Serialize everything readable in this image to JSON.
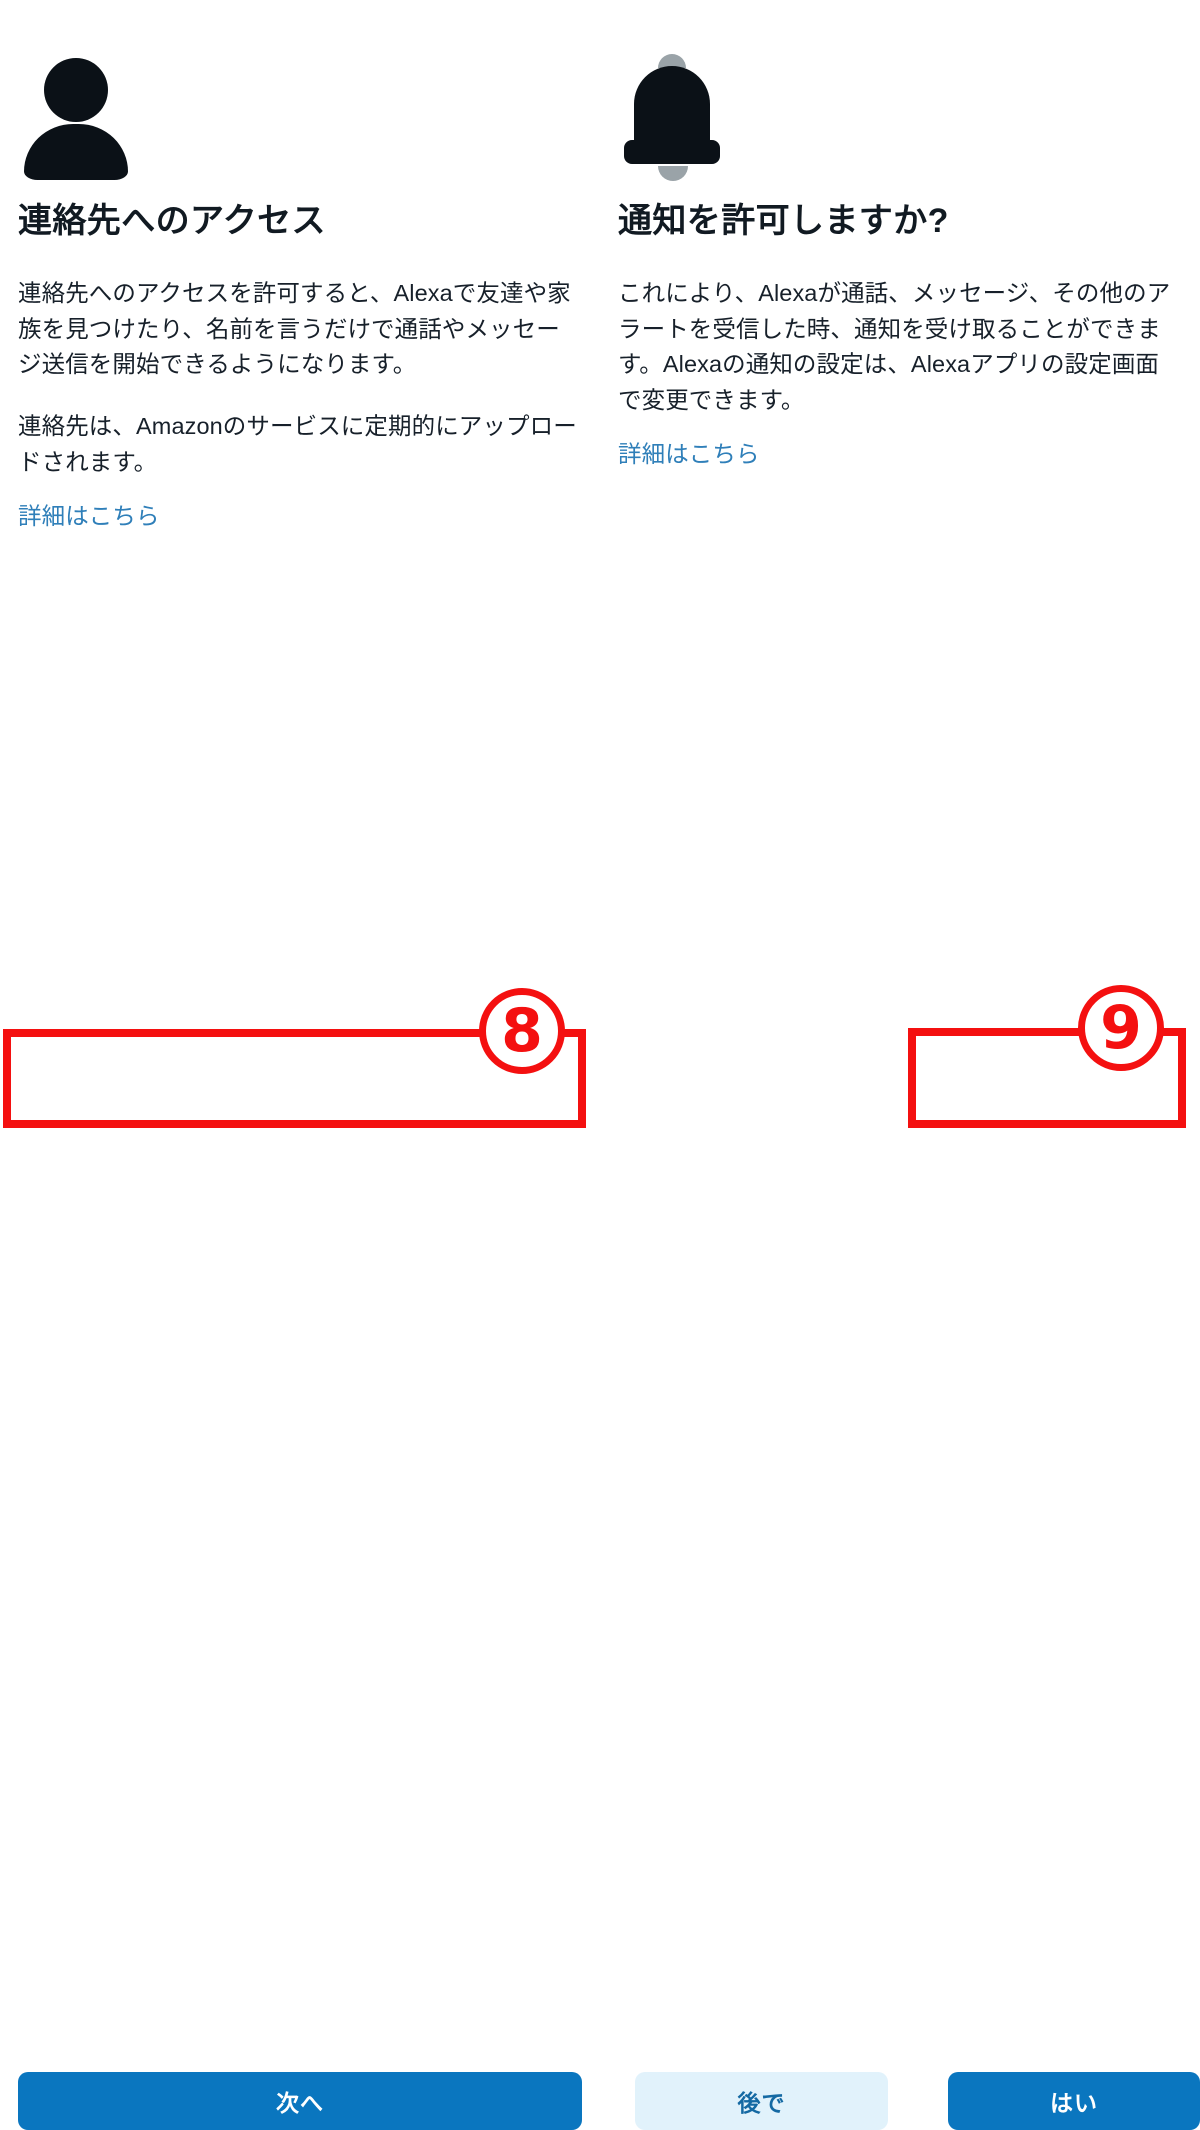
{
  "screens": [
    {
      "id": "contacts-permission",
      "icon": "person-icon",
      "heading": "連絡先へのアクセス",
      "paragraphs": [
        "連絡先へのアクセスを許可すると、Alexaで友達や家族を見つけたり、名前を言うだけで通話やメッセージ送信を開始できるようになります。",
        "連絡先は、Amazonのサービスに定期的にアップロードされます。"
      ],
      "link_label": "詳細はこちら",
      "buttons": [
        {
          "id": "next",
          "label": "次へ",
          "style": "primary"
        }
      ]
    },
    {
      "id": "notifications-permission",
      "icon": "bell-icon",
      "heading": "通知を許可しますか?",
      "paragraphs": [
        "これにより、Alexaが通話、メッセージ、その他のアラートを受信した時、通知を受け取ることができます。Alexaの通知の設定は、Alexaアプリの設定画面で変更できます。"
      ],
      "link_label": "詳細はこちら",
      "buttons": [
        {
          "id": "later",
          "label": "後で",
          "style": "secondary"
        },
        {
          "id": "yes",
          "label": "はい",
          "style": "primary"
        }
      ]
    }
  ],
  "annotations": [
    {
      "id": "step-8",
      "number": "⑧",
      "digit": "8",
      "target": "next-button"
    },
    {
      "id": "step-9",
      "number": "⑨",
      "digit": "9",
      "target": "yes-button"
    }
  ],
  "colors": {
    "primary_blue": "#0a76bf",
    "secondary_blue_bg": "#e1f2fb",
    "secondary_blue_text": "#1469a3",
    "link_blue": "#2f7fb9",
    "icon_dark": "#0b1117",
    "icon_gray": "#9aa3a8",
    "annotation_red": "#f41010",
    "heading_text": "#111a22",
    "body_text": "#17202a",
    "background": "#ffffff"
  }
}
